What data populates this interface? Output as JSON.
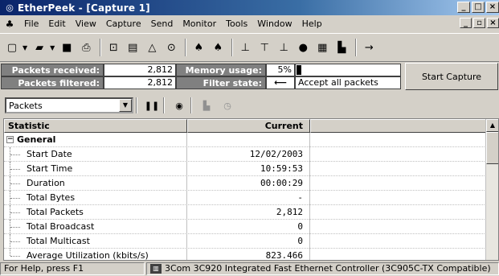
{
  "window": {
    "title": "EtherPeek - [Capture 1]"
  },
  "menu": [
    "File",
    "Edit",
    "View",
    "Capture",
    "Send",
    "Monitor",
    "Tools",
    "Window",
    "Help"
  ],
  "stats": {
    "packets_received_label": "Packets received:",
    "packets_received": "2,812",
    "packets_filtered_label": "Packets filtered:",
    "packets_filtered": "2,812",
    "memory_usage_label": "Memory usage:",
    "memory_usage": "5%",
    "filter_state_label": "Filter state:",
    "filter_state": "Accept all packets"
  },
  "start_capture_label": "Start Capture",
  "view_select": {
    "value": "Packets"
  },
  "table": {
    "columns": [
      "Statistic",
      "Current"
    ],
    "group": "General",
    "rows": [
      {
        "label": "Start Date",
        "value": "12/02/2003"
      },
      {
        "label": "Start Time",
        "value": "10:59:53"
      },
      {
        "label": "Duration",
        "value": "00:00:29"
      },
      {
        "label": "Total Bytes",
        "value": "-"
      },
      {
        "label": "Total Packets",
        "value": "2,812"
      },
      {
        "label": "Total Broadcast",
        "value": "0"
      },
      {
        "label": "Total Multicast",
        "value": "0"
      },
      {
        "label": "Average Utilization (kbits/s)",
        "value": "823.466"
      }
    ]
  },
  "status": {
    "left": "For Help, press F1",
    "adapter": "3Com 3C920 Integrated Fast Ethernet Controller (3C905C-TX Compatible)"
  },
  "icons": [
    "app-icon",
    "new-icon",
    "open-icon",
    "save-icon",
    "print-icon",
    "pause-icon",
    "camera-icon"
  ],
  "colors": {
    "title_bar": "#0a246a",
    "label_panel": "#808080",
    "chrome": "#d4d0c8"
  }
}
